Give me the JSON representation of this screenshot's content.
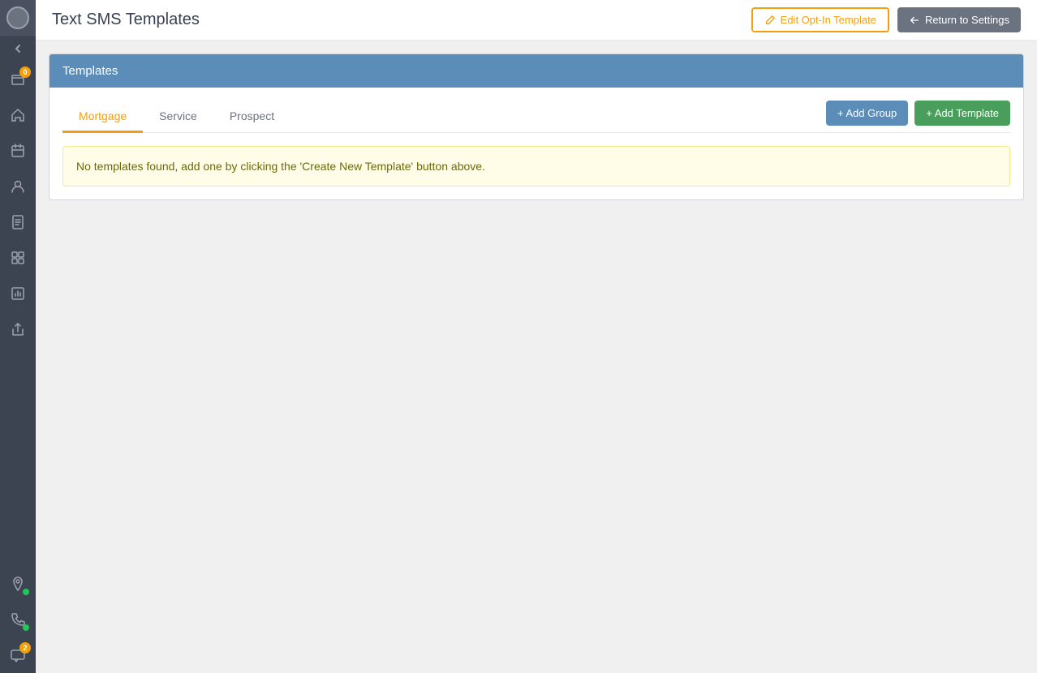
{
  "header": {
    "title": "Text SMS Templates",
    "btn_opt_in_label": "Edit Opt-In Template",
    "btn_return_label": "Return to Settings"
  },
  "templates_section": {
    "title": "Templates",
    "tabs": [
      {
        "id": "mortgage",
        "label": "Mortgage",
        "active": true
      },
      {
        "id": "service",
        "label": "Service",
        "active": false
      },
      {
        "id": "prospect",
        "label": "Prospect",
        "active": false
      }
    ],
    "btn_add_group": "+ Add Group",
    "btn_add_template": "+ Add Template",
    "empty_message": "No templates found, add one by clicking the 'Create New Template' button above."
  },
  "sidebar": {
    "notification_badge": "0",
    "bottom_badge": "2",
    "icons": [
      {
        "name": "home-icon",
        "symbol": "⌂"
      },
      {
        "name": "calendar-icon",
        "symbol": "▦"
      },
      {
        "name": "contacts-icon",
        "symbol": "👤"
      },
      {
        "name": "documents-icon",
        "symbol": "📄"
      },
      {
        "name": "box-icon",
        "symbol": "⬜"
      },
      {
        "name": "chart-icon",
        "symbol": "📊"
      },
      {
        "name": "share-icon",
        "symbol": "↗"
      }
    ]
  }
}
